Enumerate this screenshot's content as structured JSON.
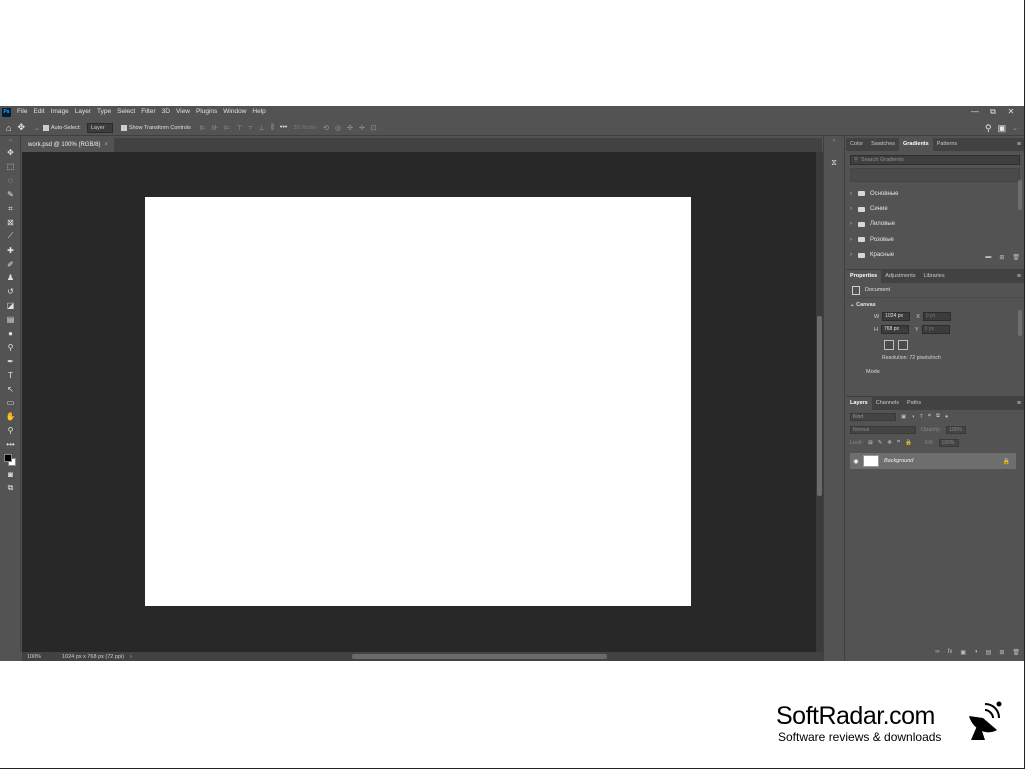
{
  "menubar": {
    "logo": "Ps",
    "items": [
      "File",
      "Edit",
      "Image",
      "Layer",
      "Type",
      "Select",
      "Filter",
      "3D",
      "View",
      "Plugins",
      "Window",
      "Help"
    ],
    "window_controls": [
      "—",
      "⧉",
      "✕"
    ]
  },
  "options": {
    "auto_select_label": "Auto-Select:",
    "auto_select_target": "Layer",
    "transform_label": "Show Transform Controls",
    "mode_3d_label": "3D Mode:",
    "more": "•••"
  },
  "document": {
    "tab_title": "work.psd @ 100% (RGB/8)",
    "close": "×"
  },
  "status": {
    "zoom": "100%",
    "size_info": "1024 px x 768 px (72 ppi)",
    "arrow": "›"
  },
  "gradients_panel": {
    "tabs": [
      "Color",
      "Swatches",
      "Gradients",
      "Patterns"
    ],
    "active_tab": "Gradients",
    "search_placeholder": "Search Gradients",
    "folders": [
      "Основные",
      "Синие",
      "Лиловые",
      "Розовые",
      "Красные"
    ]
  },
  "properties_panel": {
    "tabs": [
      "Properties",
      "Adjustments",
      "Libraries"
    ],
    "active_tab": "Properties",
    "document_label": "Document",
    "canvas_label": "Canvas",
    "w_label": "W",
    "w_value": "1024 px",
    "x_label": "X",
    "x_value": "0 px",
    "h_label": "H",
    "h_value": "768 px",
    "y_label": "Y",
    "y_value": "0 px",
    "resolution": "Resolution: 72 pixels/inch",
    "mode_label": "Mode"
  },
  "layers_panel": {
    "tabs": [
      "Layers",
      "Channels",
      "Paths"
    ],
    "active_tab": "Layers",
    "kind_placeholder": "Kind",
    "blend_mode": "Normal",
    "opacity_label": "Opacity:",
    "opacity_value": "100%",
    "lock_label": "Lock:",
    "fill_label": "Fill:",
    "fill_value": "100%",
    "layer_name": "Background",
    "footer_icons": [
      "∞",
      "fx",
      "▣",
      "◑",
      "▤",
      "⊞",
      "🗑"
    ]
  },
  "branding": {
    "name": "SoftRadar.com",
    "tagline": "Software reviews & downloads"
  },
  "colors": {
    "ui_bg": "#535353",
    "canvas_bg": "#282828",
    "foreground": "#000000",
    "background": "#ffffff"
  }
}
